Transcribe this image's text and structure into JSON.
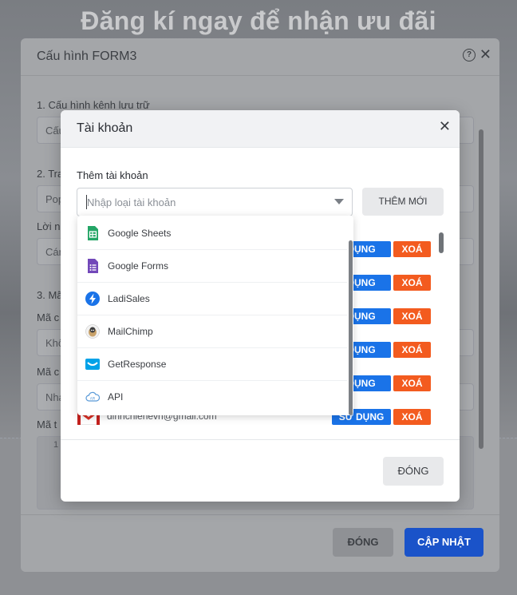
{
  "background": {
    "hero_title": "Đăng kí ngay để nhận ưu đãi"
  },
  "outer_modal": {
    "title": "Cấu hình FORM3",
    "help_icon": "question-circle-icon",
    "close_icon": "close-icon",
    "sections": {
      "storage": "1. Cấu hình kênh lưu trữ",
      "storage_value": "Cấu",
      "section2": "2. Tra",
      "section2_value": "Pop",
      "message_label": "Lời n",
      "message_value": "Cán",
      "section3": "3. Mã",
      "code_label_1": "Mã c",
      "code_value_1": "Khô",
      "code_label_2": "Mã c",
      "code_value_2": "Nha",
      "code_label_3": "Mã t",
      "code_line": "1"
    },
    "buttons": {
      "close": "ĐÓNG",
      "update": "CẬP NHẬT"
    }
  },
  "inner_modal": {
    "title": "Tài khoản",
    "close_icon": "close-icon",
    "add_label": "Thêm tài khoản",
    "select_placeholder": "Nhập loại tài khoản",
    "add_button": "THÊM MỚI",
    "accounts": [
      {
        "email": "",
        "use": "DỤNG",
        "delete": "XOÁ"
      },
      {
        "email": "",
        "use": "DỤNG",
        "delete": "XOÁ"
      },
      {
        "email": "",
        "use": "DỤNG",
        "delete": "XOÁ"
      },
      {
        "email": "",
        "use": "DỤNG",
        "delete": "XOÁ"
      },
      {
        "email": "",
        "use": "DỤNG",
        "delete": "XOÁ"
      },
      {
        "email": "dinhchienevn@gmail.com",
        "use": "SỬ DỤNG",
        "delete": "XOÁ",
        "icon": "gmail-icon"
      }
    ],
    "close_button": "ĐÓNG"
  },
  "dropdown": {
    "options": [
      {
        "label": "Google Sheets",
        "icon": "google-sheets-icon"
      },
      {
        "label": "Google Forms",
        "icon": "google-forms-icon"
      },
      {
        "label": "LadiSales",
        "icon": "ladisales-icon"
      },
      {
        "label": "MailChimp",
        "icon": "mailchimp-icon"
      },
      {
        "label": "GetResponse",
        "icon": "getresponse-icon"
      },
      {
        "label": "API",
        "icon": "api-cloud-icon"
      }
    ]
  },
  "colors": {
    "primary_blue": "#1a53c9",
    "use_blue": "#1a73e8",
    "delete_orange": "#f35b1f",
    "sheets_green": "#23a566",
    "forms_purple": "#7248b9"
  }
}
